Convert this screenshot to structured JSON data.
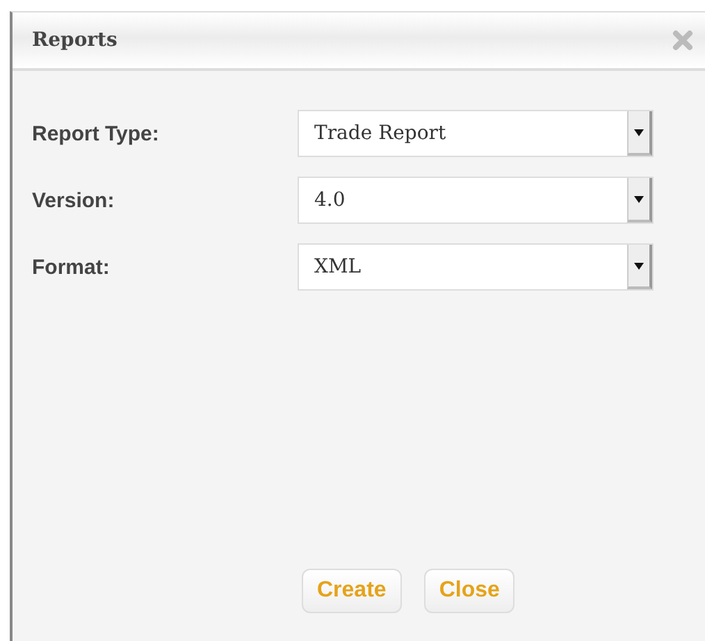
{
  "dialog": {
    "title": "Reports"
  },
  "fields": [
    {
      "label": "Report Type:",
      "value": "Trade Report"
    },
    {
      "label": "Version:",
      "value": "4.0"
    },
    {
      "label": "Format:",
      "value": "XML"
    }
  ],
  "buttons": [
    "Create",
    "Close"
  ]
}
